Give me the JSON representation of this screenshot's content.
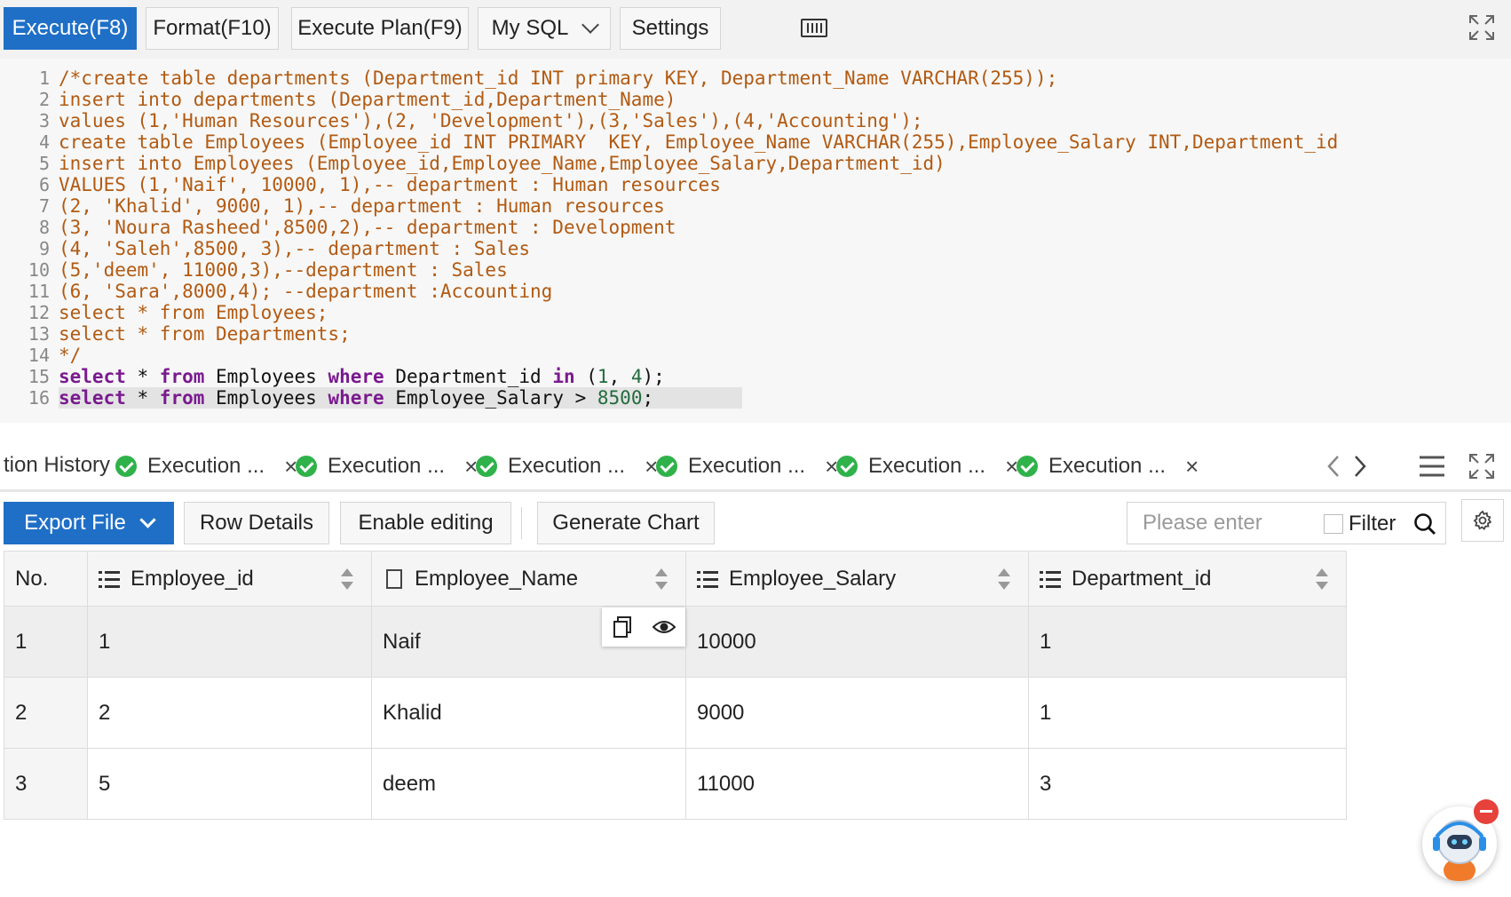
{
  "toolbar": {
    "execute_label": "Execute(F8)",
    "format_label": "Format(F10)",
    "plan_label": "Execute Plan(F9)",
    "dialect_label": "My SQL",
    "settings_label": "Settings",
    "accent": "#1f6fc7"
  },
  "editor": {
    "line_numbers": [
      "1",
      "2",
      "3",
      "4",
      "5",
      "6",
      "7",
      "8",
      "9",
      "10",
      "11",
      "12",
      "13",
      "14",
      "15",
      "16"
    ],
    "comment_lines": [
      "/*create table departments (Department_id INT primary KEY, Department_Name VARCHAR(255));",
      "insert into departments (Department_id,Department_Name)",
      "values (1,'Human Resources'),(2, 'Development'),(3,'Sales'),(4,'Accounting');",
      "create table Employees (Employee_id INT PRIMARY  KEY, Employee_Name VARCHAR(255),Employee_Salary INT,Department_id",
      "insert into Employees (Employee_id,Employee_Name,Employee_Salary,Department_id)",
      "VALUES (1,'Naif', 10000, 1),-- department : Human resources",
      "(2, 'Khalid', 9000, 1),-- department : Human resources",
      "(3, 'Noura Rasheed',8500,2),-- department : Development",
      "(4, 'Saleh',8500, 3),-- department : Sales",
      "(5,'deem', 11000,3),--department : Sales",
      "(6, 'Sara',8000,4); --department :Accounting",
      "select * from Employees;",
      "select * from Departments;",
      "*/"
    ],
    "line15": {
      "select": "select",
      "star": " * ",
      "from": "from",
      "table": " Employees ",
      "where": "where",
      "col": " Department_id ",
      "in": "in",
      "open": " (",
      "n1": "1",
      "comma": ", ",
      "n2": "4",
      "close": ");"
    },
    "line16": {
      "select": "select",
      "star": " * ",
      "from": "from",
      "table": " Employees ",
      "where": "where",
      "col": " Employee_Salary > ",
      "n": "8500",
      "end": ";"
    }
  },
  "history": {
    "title": "tion History",
    "tabs": [
      "Execution ...",
      "Execution ...",
      "Execution ...",
      "Execution ...",
      "Execution ...",
      "Execution ..."
    ],
    "close_glyph": "×",
    "success_color": "#2fb24a"
  },
  "results_toolbar": {
    "export_label": "Export File",
    "row_details_label": "Row Details",
    "enable_editing_label": "Enable editing",
    "generate_chart_label": "Generate Chart",
    "search_placeholder": "Please enter",
    "filter_label": "Filter"
  },
  "table": {
    "columns": [
      "No.",
      "Employee_id",
      "Employee_Name",
      "Employee_Salary",
      "Department_id"
    ],
    "rows": [
      [
        "1",
        "1",
        "Naif",
        "10000",
        "1"
      ],
      [
        "2",
        "2",
        "Khalid",
        "9000",
        "1"
      ],
      [
        "3",
        "5",
        "deem",
        "11000",
        "3"
      ]
    ]
  }
}
